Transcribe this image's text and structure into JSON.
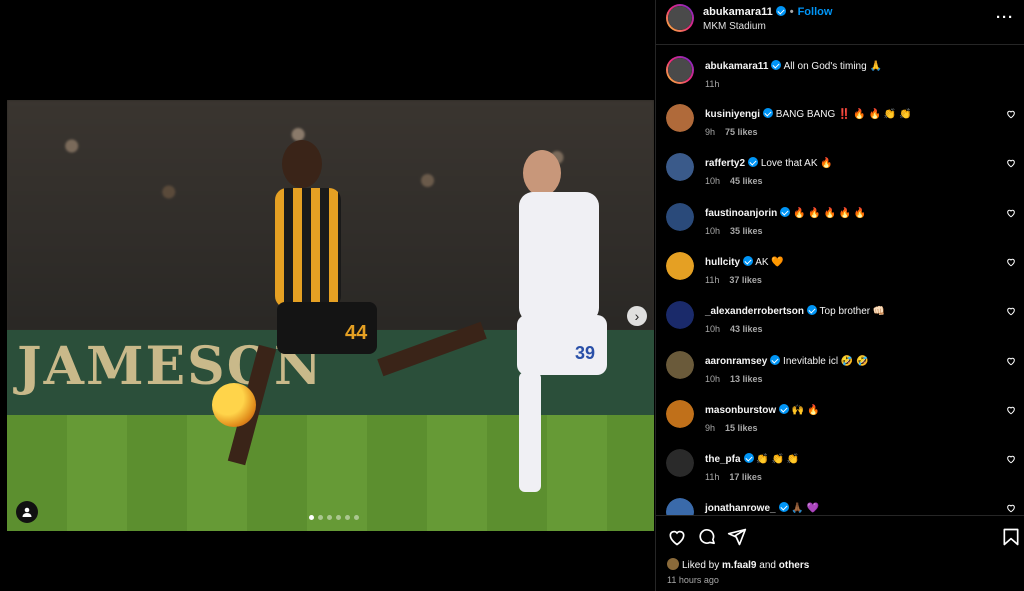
{
  "post": {
    "username": "abukamara11",
    "follow_label": "Follow",
    "separator": "•",
    "location": "MKM Stadium",
    "caption": "All on God's timing 🙏",
    "caption_time": "11h",
    "media_board_text": "JAMESON",
    "shirt_numbers": [
      "44",
      "39"
    ],
    "carousel": {
      "total": 6,
      "active": 1
    }
  },
  "comments": [
    {
      "username": "kusiniyengi",
      "text": "BANG BANG ‼️ 🔥 🔥 👏 👏",
      "time": "9h",
      "likes": "75 likes",
      "avatar_color": "#b06a3a"
    },
    {
      "username": "rafferty2",
      "text": "Love that AK 🔥",
      "time": "10h",
      "likes": "45 likes",
      "avatar_color": "#3a5a8a"
    },
    {
      "username": "faustinoanjorin",
      "text": "🔥 🔥 🔥 🔥 🔥",
      "time": "10h",
      "likes": "35 likes",
      "avatar_color": "#2a4a7a"
    },
    {
      "username": "hullcity",
      "text": "AK 🧡",
      "time": "11h",
      "likes": "37 likes",
      "avatar_color": "#e5a023"
    },
    {
      "username": "_alexanderrobertson",
      "text": "Top brother 👊🏻",
      "time": "10h",
      "likes": "43 likes",
      "avatar_color": "#1a2a6a"
    },
    {
      "username": "aaronramsey",
      "text": "Inevitable icl 🤣 🤣",
      "time": "10h",
      "likes": "13 likes",
      "avatar_color": "#6a5a3a"
    },
    {
      "username": "masonburstow",
      "text": "🙌 🔥",
      "time": "9h",
      "likes": "15 likes",
      "avatar_color": "#c0701a"
    },
    {
      "username": "the_pfa",
      "text": "👏 👏 👏",
      "time": "11h",
      "likes": "17 likes",
      "avatar_color": "#2a2a2a"
    },
    {
      "username": "jonathanrowe_",
      "text": "🙏🏾 💜",
      "time": "",
      "likes": "",
      "avatar_color": "#3a6aaa"
    }
  ],
  "footer": {
    "liked_prefix": "Liked by",
    "liked_user": "m.faal9",
    "liked_and": "and",
    "liked_others": "others",
    "time_ago": "11 hours ago"
  },
  "icons": [
    "heart-icon",
    "comment-icon",
    "share-icon",
    "bookmark-icon",
    "more-icon",
    "chevron-right-icon",
    "user-tag-icon",
    "verified-icon"
  ],
  "colors": {
    "accent": "#0095f6",
    "background": "#000000",
    "muted": "#a8a8a8"
  }
}
